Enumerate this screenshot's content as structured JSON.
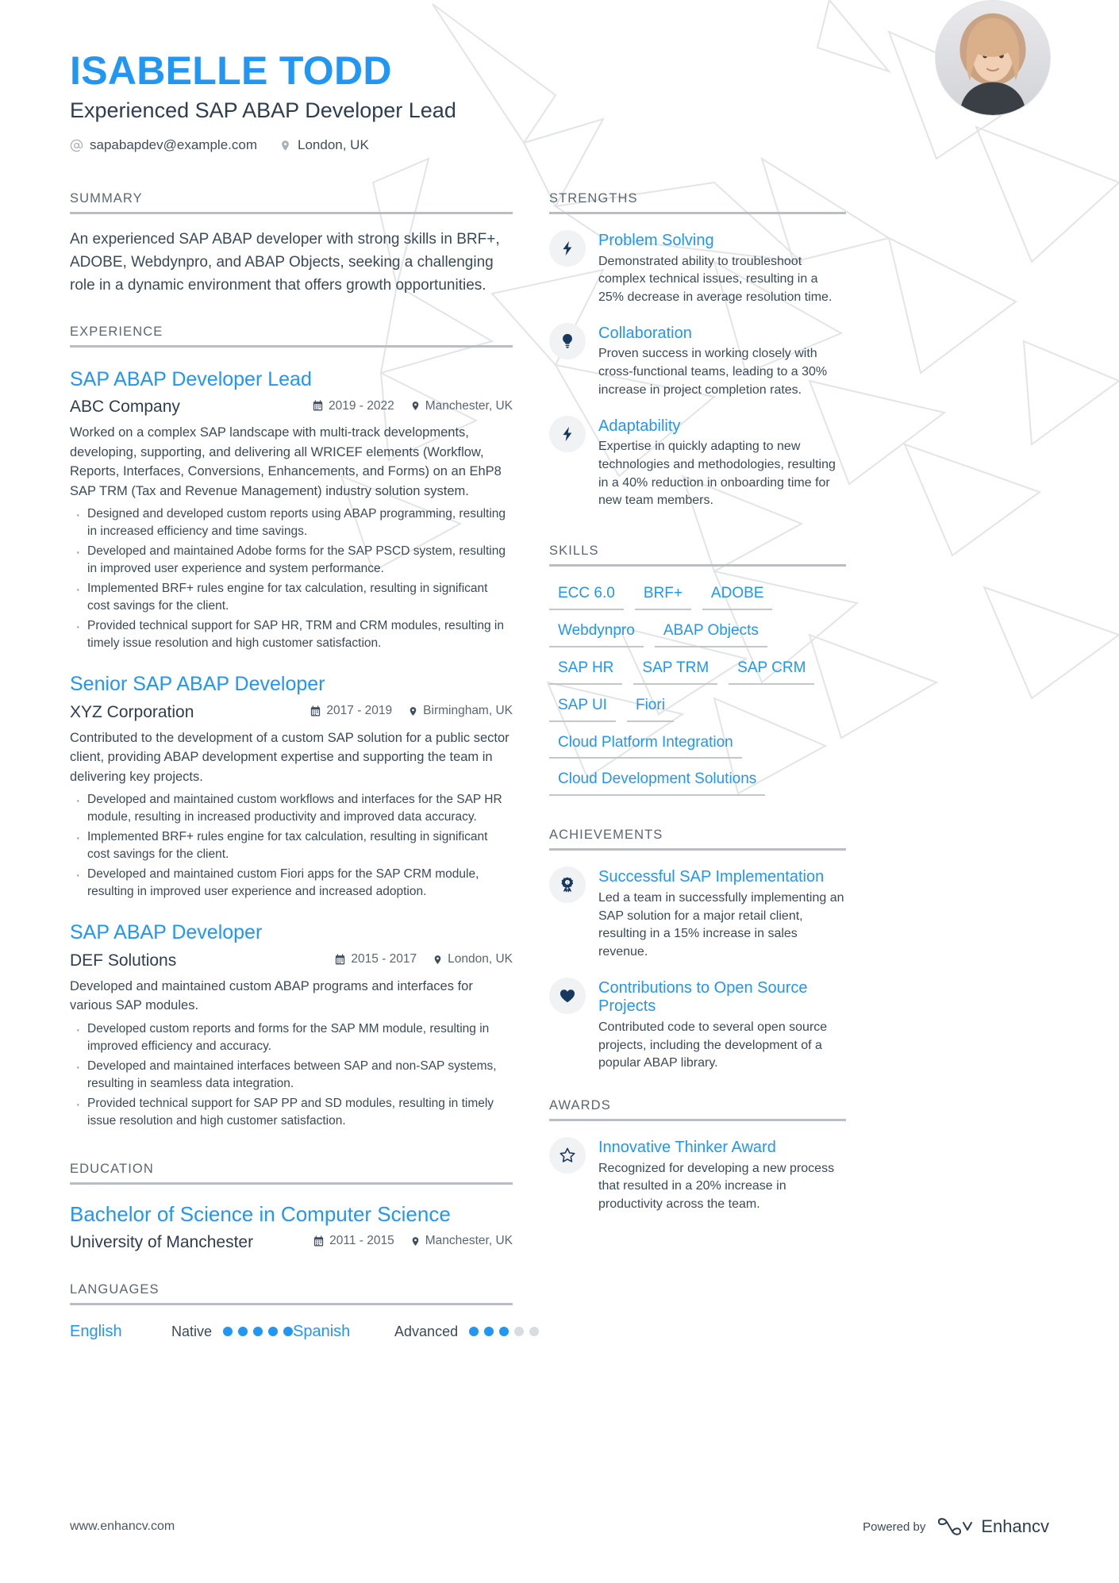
{
  "header": {
    "name": "ISABELLE TODD",
    "headline": "Experienced SAP ABAP Developer Lead",
    "email": "sapabapdev@example.com",
    "location": "London, UK"
  },
  "sections": {
    "summary_label": "SUMMARY",
    "experience_label": "EXPERIENCE",
    "education_label": "EDUCATION",
    "languages_label": "LANGUAGES",
    "strengths_label": "STRENGTHS",
    "skills_label": "SKILLS",
    "achievements_label": "ACHIEVEMENTS",
    "awards_label": "AWARDS"
  },
  "summary": {
    "text": "An experienced SAP ABAP developer with strong skills in BRF+, ADOBE, Webdynpro, and ABAP Objects, seeking a challenging role in a dynamic environment that offers growth opportunities."
  },
  "experience": [
    {
      "title": "SAP ABAP Developer Lead",
      "company": "ABC Company",
      "dates": "2019 - 2022",
      "location": "Manchester, UK",
      "description": "Worked on a complex SAP landscape with multi-track developments, developing, supporting, and delivering all WRICEF elements (Workflow, Reports, Interfaces, Conversions, Enhancements, and Forms) on an EhP8 SAP TRM (Tax and Revenue Management) industry solution system.",
      "bullets": [
        "Designed and developed custom reports using ABAP programming, resulting in increased efficiency and time savings.",
        "Developed and maintained Adobe forms for the SAP PSCD system, resulting in improved user experience and system performance.",
        "Implemented BRF+ rules engine for tax calculation, resulting in significant cost savings for the client.",
        "Provided technical support for SAP HR, TRM and CRM modules, resulting in timely issue resolution and high customer satisfaction."
      ]
    },
    {
      "title": "Senior SAP ABAP Developer",
      "company": "XYZ Corporation",
      "dates": "2017 - 2019",
      "location": "Birmingham, UK",
      "description": "Contributed to the development of a custom SAP solution for a public sector client, providing ABAP development expertise and supporting the team in delivering key projects.",
      "bullets": [
        "Developed and maintained custom workflows and interfaces for the SAP HR module, resulting in increased productivity and improved data accuracy.",
        "Implemented BRF+ rules engine for tax calculation, resulting in significant cost savings for the client.",
        "Developed and maintained custom Fiori apps for the SAP CRM module, resulting in improved user experience and increased adoption."
      ]
    },
    {
      "title": "SAP ABAP Developer",
      "company": "DEF Solutions",
      "dates": "2015 - 2017",
      "location": "London, UK",
      "description": "Developed and maintained custom ABAP programs and interfaces for various SAP modules.",
      "bullets": [
        "Developed custom reports and forms for the SAP MM module, resulting in improved efficiency and accuracy.",
        "Developed and maintained interfaces between SAP and non-SAP systems, resulting in seamless data integration.",
        "Provided technical support for SAP PP and SD modules, resulting in timely issue resolution and high customer satisfaction."
      ]
    }
  ],
  "education": [
    {
      "degree": "Bachelor of Science in Computer Science",
      "school": "University of Manchester",
      "dates": "2011 - 2015",
      "location": "Manchester, UK"
    }
  ],
  "languages": [
    {
      "name": "English",
      "level": "Native",
      "filled": 5,
      "total": 5
    },
    {
      "name": "Spanish",
      "level": "Advanced",
      "filled": 3,
      "total": 5
    }
  ],
  "strengths": [
    {
      "icon": "lightning-bolt-icon",
      "title": "Problem Solving",
      "text": "Demonstrated ability to troubleshoot complex technical issues, resulting in a 25% decrease in average resolution time."
    },
    {
      "icon": "lightbulb-icon",
      "title": "Collaboration",
      "text": "Proven success in working closely with cross-functional teams, leading to a 30% increase in project completion rates."
    },
    {
      "icon": "lightning-bolt-icon",
      "title": "Adaptability",
      "text": "Expertise in quickly adapting to new technologies and methodologies, resulting in a 40% reduction in onboarding time for new team members."
    }
  ],
  "skills": [
    "ECC 6.0",
    "BRF+",
    "ADOBE",
    "Webdynpro",
    "ABAP Objects",
    "SAP HR",
    "SAP TRM",
    "SAP CRM",
    "SAP UI",
    "Fiori",
    "Cloud Platform Integration",
    "Cloud Development Solutions"
  ],
  "achievements": [
    {
      "icon": "award-ribbon-icon",
      "title": "Successful SAP Implementation",
      "text": "Led a team in successfully implementing an SAP solution for a major retail client, resulting in a 15% increase in sales revenue."
    },
    {
      "icon": "heart-icon",
      "title": "Contributions to Open Source Projects",
      "text": "Contributed code to several open source projects, including the development of a popular ABAP library."
    }
  ],
  "awards": [
    {
      "icon": "star-icon",
      "title": "Innovative Thinker Award",
      "text": "Recognized for developing a new process that resulted in a 20% increase in productivity across the team."
    }
  ],
  "footer": {
    "url": "www.enhancv.com",
    "powered_by": "Powered by",
    "brand": "Enhancv"
  },
  "colors": {
    "accent": "#2196f3",
    "dark": "#2e3d4f",
    "muted": "#5b6672"
  }
}
